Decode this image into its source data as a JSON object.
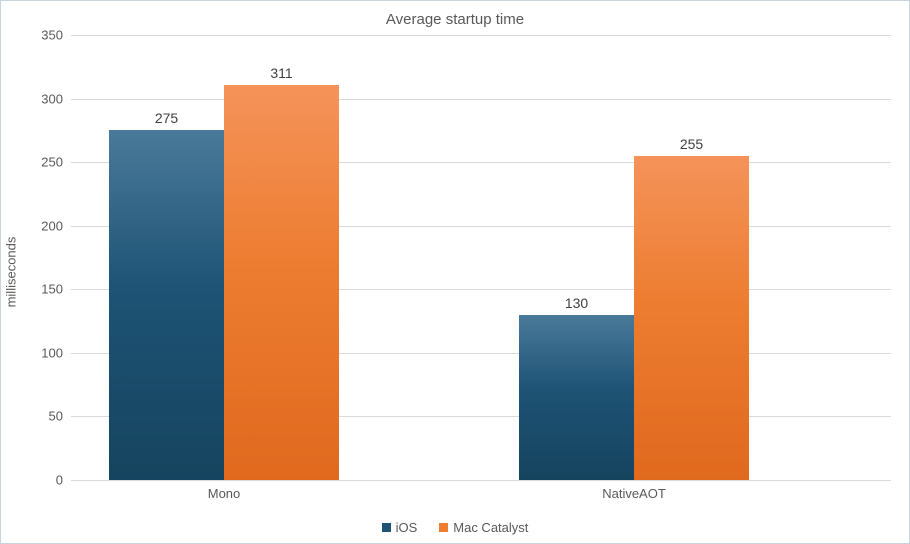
{
  "chart_data": {
    "type": "bar",
    "title": "Average startup time",
    "ylabel": "milliseconds",
    "xlabel": "",
    "categories": [
      "Mono",
      "NativeAOT"
    ],
    "series": [
      {
        "name": "iOS",
        "values": [
          275,
          130
        ],
        "color": "#1e5375"
      },
      {
        "name": "Mac Catalyst",
        "values": [
          311,
          255
        ],
        "color": "#ed7d31"
      }
    ],
    "ylim": [
      0,
      350
    ],
    "y_ticks": [
      0,
      50,
      100,
      150,
      200,
      250,
      300,
      350
    ],
    "grid": true,
    "legend_position": "bottom"
  }
}
